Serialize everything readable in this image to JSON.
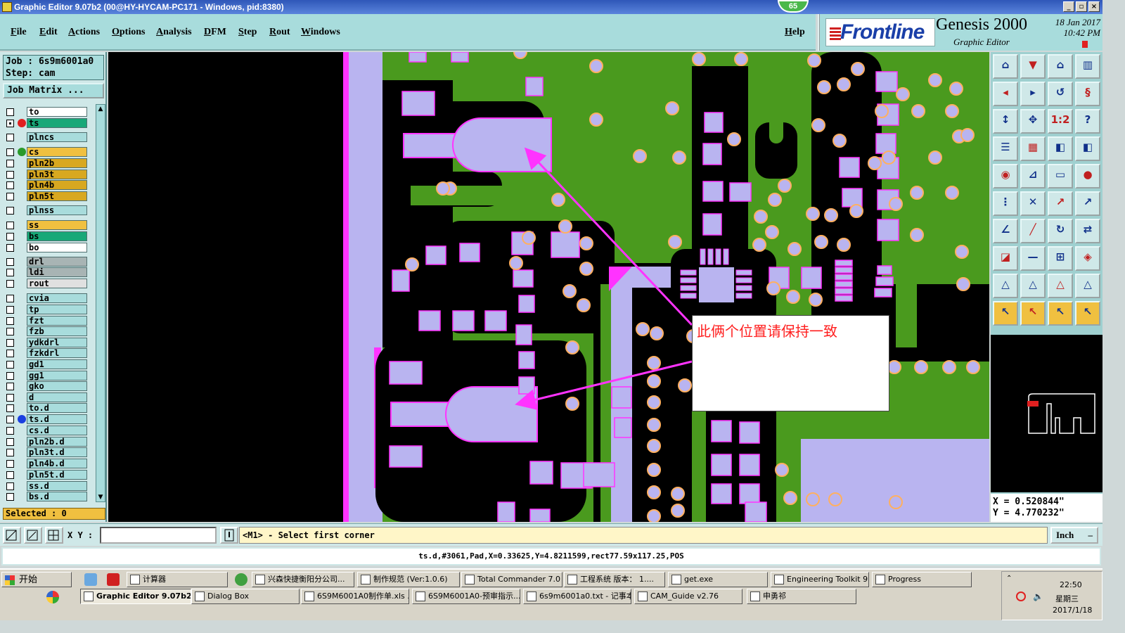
{
  "window": {
    "title": "Graphic Editor 9.07b2 (00@HY-HYCAM-PC171 - Windows, pid:8380)",
    "badge": "65"
  },
  "menu": [
    "File",
    "Edit",
    "Actions",
    "Options",
    "Analysis",
    "DFM",
    "Step",
    "Rout",
    "Windows"
  ],
  "help": "Help",
  "brand": {
    "logo": "Frontline",
    "product": "Genesis 2000",
    "sub": "Graphic Editor",
    "date": "18 Jan 2017",
    "time": "10:42 PM"
  },
  "job": {
    "job_line": "Job : 6s9m6001a0",
    "step_line": "Step: cam",
    "matrix_button": "Job Matrix ..."
  },
  "layers": [
    {
      "name": "to",
      "color": "#ffffff",
      "marker": "",
      "checked": false
    },
    {
      "name": "ts",
      "color": "#18a878",
      "marker": "#e02020",
      "checked": true
    },
    {
      "name": "plncs",
      "color": "#a8dcdc",
      "marker": "",
      "checked": false
    },
    {
      "name": "cs",
      "color": "#f0c040",
      "marker": "#2a9a2a",
      "checked": false
    },
    {
      "name": "pln2b",
      "color": "#d8a820",
      "marker": "",
      "checked": false
    },
    {
      "name": "pln3t",
      "color": "#d8a820",
      "marker": "",
      "checked": false
    },
    {
      "name": "pln4b",
      "color": "#d8a820",
      "marker": "",
      "checked": false
    },
    {
      "name": "pln5t",
      "color": "#d8a820",
      "marker": "",
      "checked": false
    },
    {
      "name": "plnss",
      "color": "#a8dcdc",
      "marker": "",
      "checked": false
    },
    {
      "name": "ss",
      "color": "#f0c040",
      "marker": "",
      "checked": false
    },
    {
      "name": "bs",
      "color": "#18a878",
      "marker": "",
      "checked": false
    },
    {
      "name": "bo",
      "color": "#ffffff",
      "marker": "",
      "checked": false
    },
    {
      "name": "drl",
      "color": "#a8b4b4",
      "marker": "",
      "checked": false
    },
    {
      "name": "ldi",
      "color": "#a8b4b4",
      "marker": "",
      "checked": false
    },
    {
      "name": "rout",
      "color": "#e0e0e0",
      "marker": "",
      "checked": false
    },
    {
      "name": "cvia",
      "color": "#a8dcdc",
      "marker": "",
      "checked": false
    },
    {
      "name": "tp",
      "color": "#a8dcdc",
      "marker": "",
      "checked": false
    },
    {
      "name": "fzt",
      "color": "#a8dcdc",
      "marker": "",
      "checked": false
    },
    {
      "name": "fzb",
      "color": "#a8dcdc",
      "marker": "",
      "checked": false
    },
    {
      "name": "ydkdrl",
      "color": "#a8dcdc",
      "marker": "",
      "checked": false
    },
    {
      "name": "fzkdrl",
      "color": "#a8dcdc",
      "marker": "",
      "checked": false
    },
    {
      "name": "gd1",
      "color": "#a8dcdc",
      "marker": "",
      "checked": false
    },
    {
      "name": "gg1",
      "color": "#a8dcdc",
      "marker": "",
      "checked": false
    },
    {
      "name": "gko",
      "color": "#a8dcdc",
      "marker": "",
      "checked": false
    },
    {
      "name": "d",
      "color": "#a8dcdc",
      "marker": "",
      "checked": false
    },
    {
      "name": "to.d",
      "color": "#a8dcdc",
      "marker": "",
      "checked": false
    },
    {
      "name": "ts.d",
      "color": "#a8dcdc",
      "marker": "#1a3fe0",
      "checked": false
    },
    {
      "name": "cs.d",
      "color": "#a8dcdc",
      "marker": "",
      "checked": false
    },
    {
      "name": "pln2b.d",
      "color": "#a8dcdc",
      "marker": "",
      "checked": false
    },
    {
      "name": "pln3t.d",
      "color": "#a8dcdc",
      "marker": "",
      "checked": false
    },
    {
      "name": "pln4b.d",
      "color": "#a8dcdc",
      "marker": "",
      "checked": false
    },
    {
      "name": "pln5t.d",
      "color": "#a8dcdc",
      "marker": "",
      "checked": false
    },
    {
      "name": "ss.d",
      "color": "#a8dcdc",
      "marker": "",
      "checked": false
    },
    {
      "name": "bs.d",
      "color": "#a8dcdc",
      "marker": "",
      "checked": false
    }
  ],
  "selected": "Selected : 0",
  "annotation": "此俩个位置请保持一致",
  "coords": {
    "x": "X = 0.520844\"",
    "y": "Y = 4.770232\""
  },
  "command": {
    "xy_label": "X Y :",
    "xy_value": "",
    "prompt": "<M1> - Select first corner",
    "unit": "Inch"
  },
  "status": "ts.d,#3061,Pad,X=0.33625,Y=4.8211599,rect77.59x117.25,POS",
  "taskbar": {
    "start": "开始",
    "row1": [
      "计算器",
      "兴森快捷衡阳分公司...",
      "制作规范 (Ver:1.0.6)",
      "Total Commander 7.0 ...",
      "工程系统   版本： 1....",
      "get.exe",
      "Engineering Toolkit 9....",
      "Progress"
    ],
    "row2": [
      "Graphic Editor 9.07b2 ...",
      "Dialog Box",
      "6S9M6001A0制作单.xls ...",
      "6S9M6001A0-预审指示....",
      "6s9m6001a0.txt - 记事本",
      "CAM_Guide v2.76",
      "申勇祁"
    ],
    "time": "22:50",
    "weekday": "星期三",
    "date": "2017/1/18"
  },
  "colors": {
    "board": "#4a9a1e",
    "pad": "#b9b4f0",
    "pad_outline": "#ff33ff",
    "via_ring": "#ffb060",
    "void": "#000000"
  }
}
